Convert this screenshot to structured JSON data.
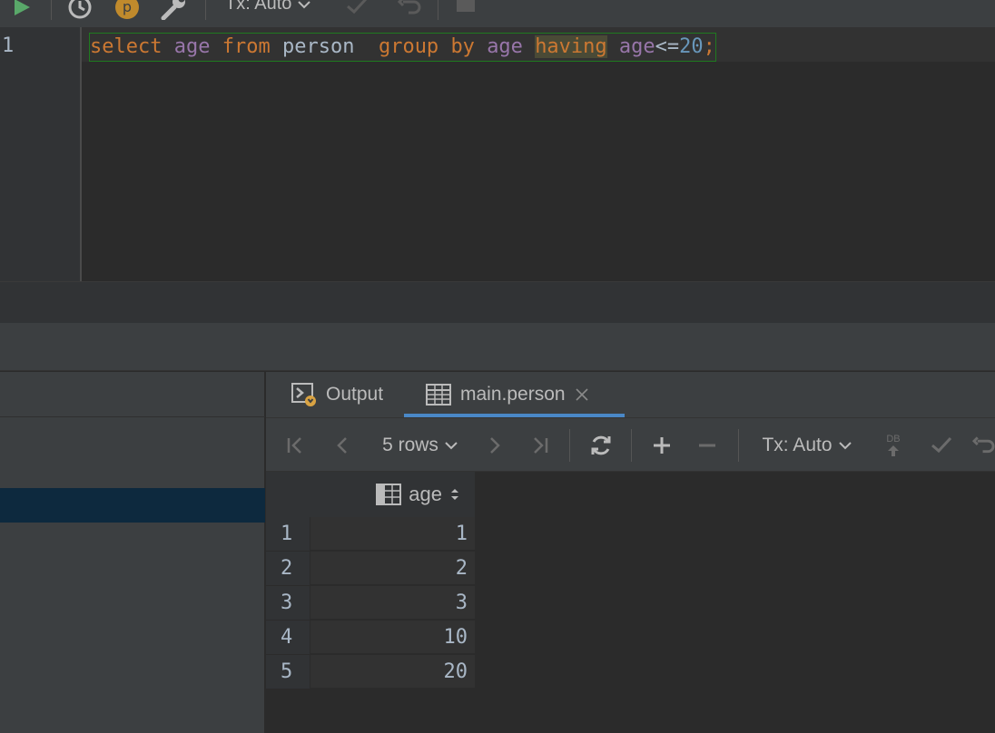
{
  "toolbar": {
    "tx_label": "Tx: Auto"
  },
  "editor": {
    "line_number": "1",
    "tokens": {
      "select": "select",
      "age1": "age",
      "from": "from",
      "person": "person",
      "group": "group",
      "by": "by",
      "age2": "age",
      "having": "having",
      "age3": "age",
      "op": "<=",
      "num": "20",
      "semi": ";"
    }
  },
  "results": {
    "tabs": [
      {
        "label": "Output"
      },
      {
        "label": "main.person"
      }
    ],
    "toolbar": {
      "rows_label": "5 rows",
      "tx_label": "Tx: Auto",
      "db_label": "DB"
    },
    "grid": {
      "column": "age",
      "rows": [
        {
          "num": "1",
          "age": "1"
        },
        {
          "num": "2",
          "age": "2"
        },
        {
          "num": "3",
          "age": "3"
        },
        {
          "num": "4",
          "age": "10"
        },
        {
          "num": "5",
          "age": "20"
        }
      ]
    }
  },
  "colors": {
    "keyword": "#cc7832",
    "column": "#9876aa",
    "identifier": "#a9b7c6",
    "number": "#6897bb",
    "selection": "#0d293e",
    "run_green": "#59a869",
    "accent_tab": "#4a88c7"
  }
}
